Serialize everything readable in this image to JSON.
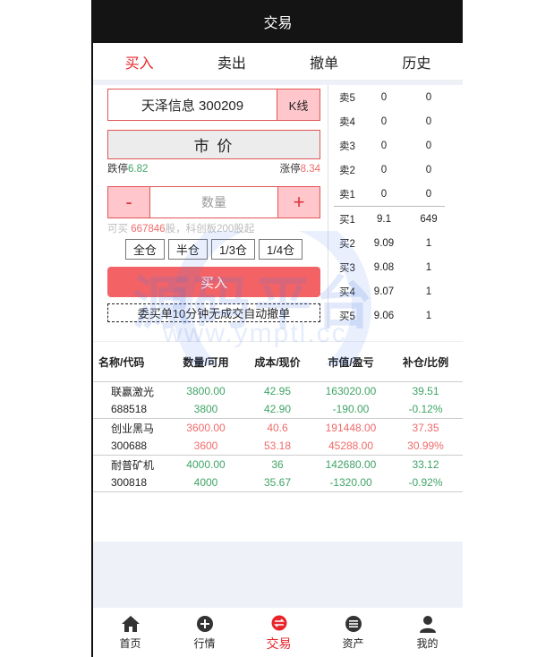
{
  "header": {
    "title": "交易"
  },
  "tabs": [
    {
      "label": "买入",
      "active": true
    },
    {
      "label": "卖出"
    },
    {
      "label": "撤单"
    },
    {
      "label": "历史"
    }
  ],
  "order_form": {
    "stock": "天泽信息 300209",
    "kline_label": "K线",
    "price_type": "市 价",
    "limit_down_label": "跌停",
    "limit_down_value": "6.82",
    "limit_up_label": "涨停",
    "limit_up_value": "8.34",
    "minus_label": "-",
    "plus_label": "+",
    "quantity_placeholder": "数量",
    "avail_prefix": "可买 ",
    "avail_value": "667846",
    "avail_suffix": "股，科创板200股起",
    "position_buttons": [
      "全仓",
      "半仓",
      "1/3仓",
      "1/4仓"
    ],
    "buy_label": "买入",
    "notice": "委买单10分钟无成交自动撤单"
  },
  "order_book": {
    "sell": [
      {
        "label": "卖5",
        "price": "0",
        "volume": "0"
      },
      {
        "label": "卖4",
        "price": "0",
        "volume": "0"
      },
      {
        "label": "卖3",
        "price": "0",
        "volume": "0"
      },
      {
        "label": "卖2",
        "price": "0",
        "volume": "0"
      },
      {
        "label": "卖1",
        "price": "0",
        "volume": "0"
      }
    ],
    "buy": [
      {
        "label": "买1",
        "price": "9.1",
        "volume": "649"
      },
      {
        "label": "买2",
        "price": "9.09",
        "volume": "1"
      },
      {
        "label": "买3",
        "price": "9.08",
        "volume": "1"
      },
      {
        "label": "买4",
        "price": "9.07",
        "volume": "1"
      },
      {
        "label": "买5",
        "price": "9.06",
        "volume": "1"
      }
    ]
  },
  "holdings": {
    "headers": [
      "名称/代码",
      "数量/可用",
      "成本/现价",
      "市值/盈亏",
      "补仓/比例"
    ],
    "rows": [
      {
        "name": "联赢激光",
        "code": "688518",
        "qty": "3800.00",
        "avail": "3800",
        "cost": "42.95",
        "price": "42.90",
        "mv": "163020.00",
        "pnl": "-190.00",
        "add": "39.51",
        "ratio": "-0.12%",
        "color": "g"
      },
      {
        "name": "创业黑马",
        "code": "300688",
        "qty": "3600.00",
        "avail": "3600",
        "cost": "40.6",
        "price": "53.18",
        "mv": "191448.00",
        "pnl": "45288.00",
        "add": "37.35",
        "ratio": "30.99%",
        "color": "r"
      },
      {
        "name": "耐普矿机",
        "code": "300818",
        "qty": "4000.00",
        "avail": "4000",
        "cost": "36",
        "price": "35.67",
        "mv": "142680.00",
        "pnl": "-1320.00",
        "add": "33.12",
        "ratio": "-0.92%",
        "color": "g"
      }
    ]
  },
  "watermark": {
    "text": "源码平台",
    "url": "www.ymptl.cc"
  },
  "nav": [
    {
      "label": "首页",
      "icon": "home-icon"
    },
    {
      "label": "行情",
      "icon": "plus-circle-icon"
    },
    {
      "label": "交易",
      "icon": "exchange-icon",
      "active": true
    },
    {
      "label": "资产",
      "icon": "asset-icon"
    },
    {
      "label": "我的",
      "icon": "user-icon"
    }
  ]
}
